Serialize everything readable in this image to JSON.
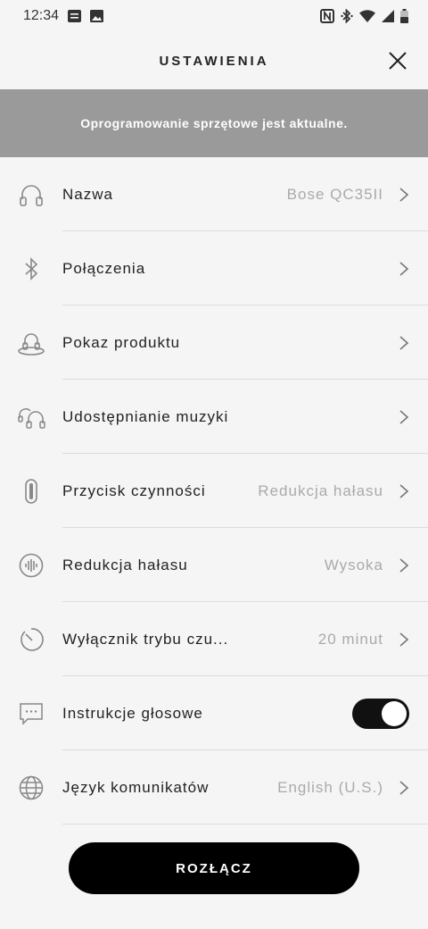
{
  "status_bar": {
    "time": "12:34"
  },
  "header": {
    "title": "USTAWIENIA"
  },
  "banner": {
    "text": "Oprogramowanie sprzętowe jest aktualne."
  },
  "settings": [
    {
      "label": "Nazwa",
      "value": "Bose QC35II",
      "icon": "headphones-icon"
    },
    {
      "label": "Połączenia",
      "value": "",
      "icon": "bluetooth-icon"
    },
    {
      "label": "Pokaz produktu",
      "value": "",
      "icon": "product-demo-icon"
    },
    {
      "label": "Udostępnianie muzyki",
      "value": "",
      "icon": "music-share-icon"
    },
    {
      "label": "Przycisk czynności",
      "value": "Redukcja hałasu",
      "icon": "action-button-icon"
    },
    {
      "label": "Redukcja hałasu",
      "value": "Wysoka",
      "icon": "noise-cancelling-icon"
    },
    {
      "label": "Wyłącznik trybu czu...",
      "value": "20 minut",
      "icon": "timer-icon"
    },
    {
      "label": "Instrukcje głosowe",
      "value": "",
      "icon": "voice-prompt-icon",
      "toggle_on": true
    },
    {
      "label": "Język komunikatów",
      "value": "English (U.S.)",
      "icon": "globe-icon"
    }
  ],
  "disconnect_label": "ROZŁĄCZ"
}
